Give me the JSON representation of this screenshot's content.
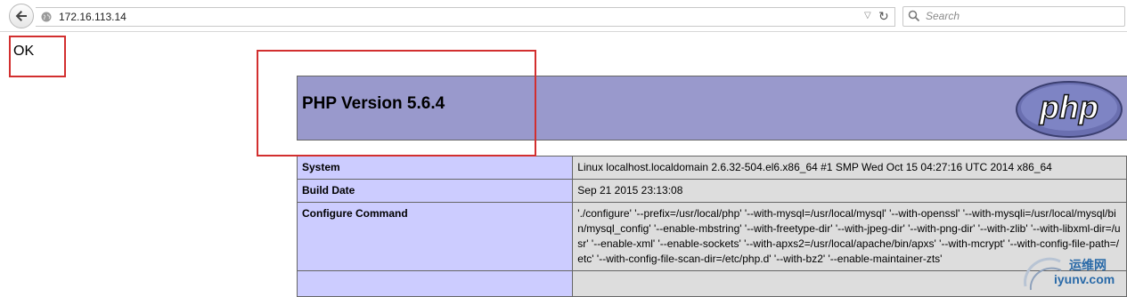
{
  "browser": {
    "url": "172.16.113.14",
    "search_placeholder": "Search",
    "icons": [
      "back-arrow-icon",
      "globe-icon",
      "dropdown-icon",
      "reload-icon",
      "search-icon"
    ]
  },
  "page": {
    "ok_text": "OK",
    "php_title": "PHP Version 5.6.4",
    "logo_text": "php",
    "rows": [
      {
        "key": "System",
        "value": "Linux localhost.localdomain 2.6.32-504.el6.x86_64 #1 SMP Wed Oct 15 04:27:16 UTC 2014 x86_64"
      },
      {
        "key": "Build Date",
        "value": "Sep 21 2015 23:13:08"
      },
      {
        "key": "Configure Command",
        "value": "'./configure' '--prefix=/usr/local/php' '--with-mysql=/usr/local/mysql' '--with-openssl' '--with-mysqli=/usr/local/mysql/bin/mysql_config' '--enable-mbstring' '--with-freetype-dir' '--with-jpeg-dir' '--with-png-dir' '--with-zlib' '--with-libxml-dir=/usr' '--enable-xml' '--enable-sockets' '--with-apxs2=/usr/local/apache/bin/apxs' '--with-mcrypt' '--with-config-file-path=/etc' '--with-config-file-scan-dir=/etc/php.d' '--with-bz2' '--enable-maintainer-zts'"
      },
      {
        "key": "",
        "value": ""
      }
    ]
  },
  "watermark": {
    "cn": "运维网",
    "en": "iyunv.com"
  },
  "colors": {
    "header_bg": "#9999cc",
    "key_bg": "#ccccff",
    "value_bg": "#dddddd",
    "highlight_box": "#d22f2f"
  }
}
